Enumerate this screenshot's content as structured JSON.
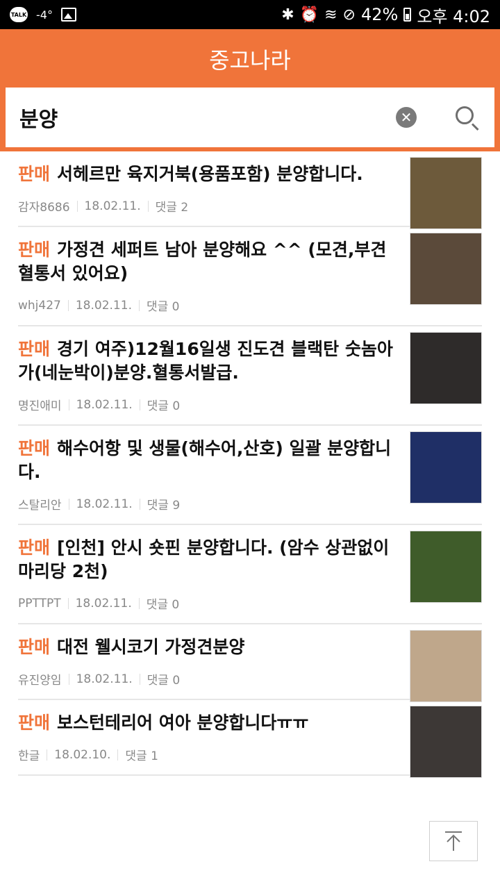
{
  "status_bar": {
    "talk_badge": "TALK",
    "temperature": "-4°",
    "battery_percent": "42%",
    "time": "오후 4:02",
    "icons": [
      "talk-icon",
      "image-icon",
      "bluetooth-icon",
      "alarm-icon",
      "wifi-icon",
      "dnd-icon",
      "battery-icon"
    ]
  },
  "header": {
    "title": "중고나라",
    "search_value": "분양",
    "clear_icon": "clear-icon",
    "search_icon": "search-icon",
    "accent_color": "#f0743a"
  },
  "items": [
    {
      "tag": "판매",
      "title": "서헤르만 육지거북(용품포함) 분양합니다.",
      "author": "감자8686",
      "date": "18.02.11.",
      "comments": "댓글 2",
      "thumb_color": "#6d5a3b"
    },
    {
      "tag": "판매",
      "title": "가정견 세퍼트 남아 분양해요 ^^ (모견,부견 혈통서 있어요)",
      "author": "whj427",
      "date": "18.02.11.",
      "comments": "댓글 0",
      "thumb_color": "#5b4a3a"
    },
    {
      "tag": "판매",
      "title": "경기 여주)12월16일생 진도견 블랙탄 숫놈아가(네눈박이)분양.혈통서발급.",
      "author": "명진애미",
      "date": "18.02.11.",
      "comments": "댓글 0",
      "thumb_color": "#2e2b2a"
    },
    {
      "tag": "판매",
      "title": "해수어항 및 생물(해수어,산호) 일괄 분양합니다.",
      "author": "스탈리안",
      "date": "18.02.11.",
      "comments": "댓글 9",
      "thumb_color": "#1f2f66"
    },
    {
      "tag": "판매",
      "title": "[인천] 안시 숏핀 분양합니다. (암수 상관없이 마리당 2천)",
      "author": "PPTTPT",
      "date": "18.02.11.",
      "comments": "댓글 0",
      "thumb_color": "#3f5c2a"
    },
    {
      "tag": "판매",
      "title": "대전 웰시코기 가정견분양",
      "author": "유진양임",
      "date": "18.02.11.",
      "comments": "댓글 0",
      "thumb_color": "#bfa78b"
    },
    {
      "tag": "판매",
      "title": "보스턴테리어 여아 분양합니다ㅠㅠ",
      "author": "한글",
      "date": "18.02.10.",
      "comments": "댓글 1",
      "thumb_color": "#3d3836"
    }
  ],
  "scroll_top_icon": "arrow-up-icon"
}
